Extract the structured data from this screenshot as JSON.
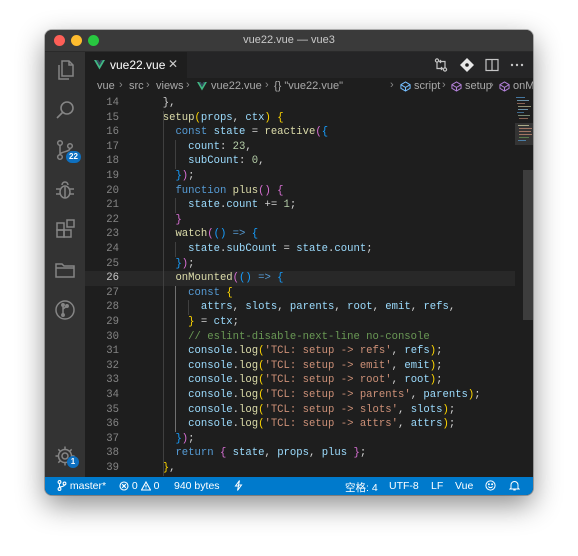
{
  "window": {
    "title": "vue22.vue — vue3"
  },
  "activity_bar": {
    "items": [
      {
        "name": "explorer",
        "icon": "files-icon"
      },
      {
        "name": "search",
        "icon": "search-icon"
      },
      {
        "name": "source-control",
        "icon": "source-control-icon",
        "badge": "22"
      },
      {
        "name": "debug",
        "icon": "bug-icon"
      },
      {
        "name": "extensions",
        "icon": "extensions-icon"
      },
      {
        "name": "folders",
        "icon": "folder-icon"
      },
      {
        "name": "timeline",
        "icon": "git-graph-icon"
      },
      {
        "name": "manage",
        "icon": "gear-icon",
        "badge": "1"
      }
    ]
  },
  "tab": {
    "label": "vue22.vue",
    "close": "✕"
  },
  "breadcrumb": {
    "items": [
      "vue",
      "src",
      "views",
      "vue22.vue",
      "{} \"vue22.vue\"",
      "script",
      "setup",
      "onMount"
    ],
    "separator": "›"
  },
  "editor": {
    "current_line": "26",
    "lines": [
      {
        "n": "14",
        "indent": 2,
        "tokens": [
          [
            "p",
            "},"
          ]
        ]
      },
      {
        "n": "15",
        "indent": 2,
        "tokens": [
          [
            "fn",
            "setup"
          ],
          [
            "b1",
            "("
          ],
          [
            "var",
            "props"
          ],
          [
            "p",
            ", "
          ],
          [
            "var",
            "ctx"
          ],
          [
            "b1",
            ")"
          ],
          [
            "p",
            " "
          ],
          [
            "b1",
            "{"
          ]
        ]
      },
      {
        "n": "16",
        "indent": 4,
        "tokens": [
          [
            "kw",
            "const "
          ],
          [
            "var",
            "state"
          ],
          [
            "p",
            " = "
          ],
          [
            "fn",
            "reactive"
          ],
          [
            "b2",
            "("
          ],
          [
            "b3",
            "{"
          ]
        ]
      },
      {
        "n": "17",
        "indent": 6,
        "tokens": [
          [
            "var",
            "count"
          ],
          [
            "p",
            ": "
          ],
          [
            "num",
            "23"
          ],
          [
            "p",
            ","
          ]
        ]
      },
      {
        "n": "18",
        "indent": 6,
        "tokens": [
          [
            "var",
            "subCount"
          ],
          [
            "p",
            ": "
          ],
          [
            "num",
            "0"
          ],
          [
            "p",
            ","
          ]
        ]
      },
      {
        "n": "19",
        "indent": 4,
        "tokens": [
          [
            "b3",
            "}"
          ],
          [
            "b2",
            ")"
          ],
          [
            "p",
            ";"
          ]
        ]
      },
      {
        "n": "20",
        "indent": 4,
        "tokens": [
          [
            "kw",
            "function "
          ],
          [
            "fn",
            "plus"
          ],
          [
            "b2",
            "()"
          ],
          [
            "p",
            " "
          ],
          [
            "b2",
            "{"
          ]
        ]
      },
      {
        "n": "21",
        "indent": 6,
        "tokens": [
          [
            "var",
            "state"
          ],
          [
            "p",
            "."
          ],
          [
            "var",
            "count"
          ],
          [
            "p",
            " += "
          ],
          [
            "num",
            "1"
          ],
          [
            "p",
            ";"
          ]
        ]
      },
      {
        "n": "22",
        "indent": 4,
        "tokens": [
          [
            "b2",
            "}"
          ]
        ]
      },
      {
        "n": "23",
        "indent": 4,
        "tokens": [
          [
            "fn",
            "watch"
          ],
          [
            "b2",
            "("
          ],
          [
            "b3",
            "()"
          ],
          [
            "p",
            " "
          ],
          [
            "kw",
            "=>"
          ],
          [
            "p",
            " "
          ],
          [
            "b3",
            "{"
          ]
        ]
      },
      {
        "n": "24",
        "indent": 6,
        "tokens": [
          [
            "var",
            "state"
          ],
          [
            "p",
            "."
          ],
          [
            "var",
            "subCount"
          ],
          [
            "p",
            " = "
          ],
          [
            "var",
            "state"
          ],
          [
            "p",
            "."
          ],
          [
            "var",
            "count"
          ],
          [
            "p",
            ";"
          ]
        ]
      },
      {
        "n": "25",
        "indent": 4,
        "tokens": [
          [
            "b3",
            "}"
          ],
          [
            "b2",
            ")"
          ],
          [
            "p",
            ";"
          ]
        ]
      },
      {
        "n": "26",
        "indent": 4,
        "tokens": [
          [
            "fn",
            "onMounted"
          ],
          [
            "b2",
            "("
          ],
          [
            "b3",
            "()"
          ],
          [
            "p",
            " "
          ],
          [
            "kw",
            "=>"
          ],
          [
            "p",
            " "
          ],
          [
            "b3",
            "{"
          ]
        ]
      },
      {
        "n": "27",
        "indent": 6,
        "tokens": [
          [
            "kw",
            "const "
          ],
          [
            "b1",
            "{"
          ]
        ]
      },
      {
        "n": "28",
        "indent": 8,
        "tokens": [
          [
            "var",
            "attrs"
          ],
          [
            "p",
            ", "
          ],
          [
            "var",
            "slots"
          ],
          [
            "p",
            ", "
          ],
          [
            "var",
            "parents"
          ],
          [
            "p",
            ", "
          ],
          [
            "var",
            "root"
          ],
          [
            "p",
            ", "
          ],
          [
            "var",
            "emit"
          ],
          [
            "p",
            ", "
          ],
          [
            "var",
            "refs"
          ],
          [
            "p",
            ","
          ]
        ]
      },
      {
        "n": "29",
        "indent": 6,
        "tokens": [
          [
            "b1",
            "}"
          ],
          [
            "p",
            " = "
          ],
          [
            "var",
            "ctx"
          ],
          [
            "p",
            ";"
          ]
        ]
      },
      {
        "n": "30",
        "indent": 6,
        "tokens": [
          [
            "cmt",
            "// eslint-disable-next-line no-console"
          ]
        ]
      },
      {
        "n": "31",
        "indent": 6,
        "tokens": [
          [
            "var",
            "console"
          ],
          [
            "p",
            "."
          ],
          [
            "fn",
            "log"
          ],
          [
            "b1",
            "("
          ],
          [
            "str",
            "'TCL: setup -> refs'"
          ],
          [
            "p",
            ", "
          ],
          [
            "var",
            "refs"
          ],
          [
            "b1",
            ")"
          ],
          [
            "p",
            ";"
          ]
        ]
      },
      {
        "n": "32",
        "indent": 6,
        "tokens": [
          [
            "var",
            "console"
          ],
          [
            "p",
            "."
          ],
          [
            "fn",
            "log"
          ],
          [
            "b1",
            "("
          ],
          [
            "str",
            "'TCL: setup -> emit'"
          ],
          [
            "p",
            ", "
          ],
          [
            "var",
            "emit"
          ],
          [
            "b1",
            ")"
          ],
          [
            "p",
            ";"
          ]
        ]
      },
      {
        "n": "33",
        "indent": 6,
        "tokens": [
          [
            "var",
            "console"
          ],
          [
            "p",
            "."
          ],
          [
            "fn",
            "log"
          ],
          [
            "b1",
            "("
          ],
          [
            "str",
            "'TCL: setup -> root'"
          ],
          [
            "p",
            ", "
          ],
          [
            "var",
            "root"
          ],
          [
            "b1",
            ")"
          ],
          [
            "p",
            ";"
          ]
        ]
      },
      {
        "n": "34",
        "indent": 6,
        "tokens": [
          [
            "var",
            "console"
          ],
          [
            "p",
            "."
          ],
          [
            "fn",
            "log"
          ],
          [
            "b1",
            "("
          ],
          [
            "str",
            "'TCL: setup -> parents'"
          ],
          [
            "p",
            ", "
          ],
          [
            "var",
            "parents"
          ],
          [
            "b1",
            ")"
          ],
          [
            "p",
            ";"
          ]
        ]
      },
      {
        "n": "35",
        "indent": 6,
        "tokens": [
          [
            "var",
            "console"
          ],
          [
            "p",
            "."
          ],
          [
            "fn",
            "log"
          ],
          [
            "b1",
            "("
          ],
          [
            "str",
            "'TCL: setup -> slots'"
          ],
          [
            "p",
            ", "
          ],
          [
            "var",
            "slots"
          ],
          [
            "b1",
            ")"
          ],
          [
            "p",
            ";"
          ]
        ]
      },
      {
        "n": "36",
        "indent": 6,
        "tokens": [
          [
            "var",
            "console"
          ],
          [
            "p",
            "."
          ],
          [
            "fn",
            "log"
          ],
          [
            "b1",
            "("
          ],
          [
            "str",
            "'TCL: setup -> attrs'"
          ],
          [
            "p",
            ", "
          ],
          [
            "var",
            "attrs"
          ],
          [
            "b1",
            ")"
          ],
          [
            "p",
            ";"
          ]
        ]
      },
      {
        "n": "37",
        "indent": 4,
        "tokens": [
          [
            "b3",
            "}"
          ],
          [
            "b2",
            ")"
          ],
          [
            "p",
            ";"
          ]
        ]
      },
      {
        "n": "38",
        "indent": 4,
        "tokens": [
          [
            "kw",
            "return "
          ],
          [
            "b2",
            "{"
          ],
          [
            "p",
            " "
          ],
          [
            "var",
            "state"
          ],
          [
            "p",
            ", "
          ],
          [
            "var",
            "props"
          ],
          [
            "p",
            ", "
          ],
          [
            "var",
            "plus"
          ],
          [
            "p",
            " "
          ],
          [
            "b2",
            "}"
          ],
          [
            "p",
            ";"
          ]
        ]
      },
      {
        "n": "39",
        "indent": 2,
        "tokens": [
          [
            "b1",
            "}"
          ],
          [
            "p",
            ","
          ]
        ]
      }
    ]
  },
  "status_bar": {
    "branch": "master*",
    "errors": "0",
    "warnings": "0",
    "file_size": "940 bytes",
    "indent": "空格: 4",
    "encoding": "UTF-8",
    "eol": "LF",
    "language": "Vue"
  },
  "colors": {
    "accent": "#007acc",
    "keyword": "#569cd6",
    "function": "#dcdcaa",
    "variable": "#9cdcfe",
    "string": "#ce9178",
    "number": "#b5cea8",
    "comment": "#6a9955",
    "vue_green": "#41b883"
  }
}
